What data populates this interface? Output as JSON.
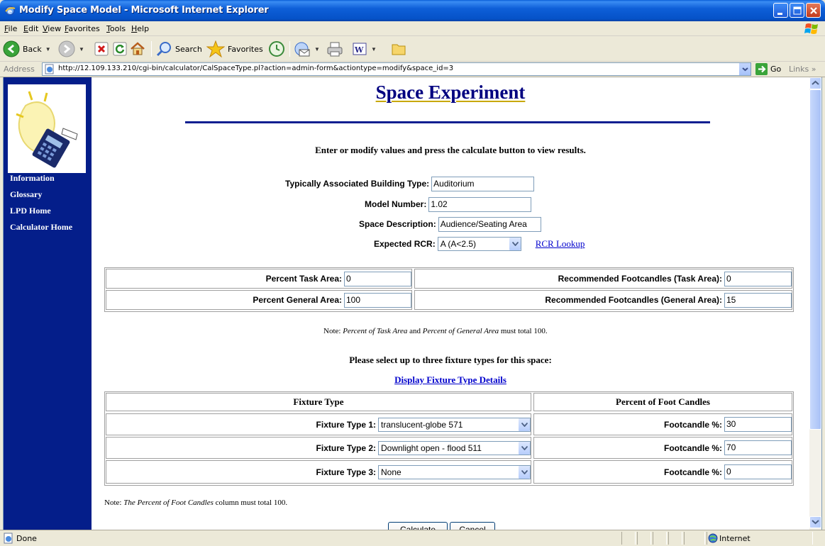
{
  "window": {
    "title": "Modify Space Model - Microsoft Internet Explorer"
  },
  "menu": [
    "File",
    "Edit",
    "View",
    "Favorites",
    "Tools",
    "Help"
  ],
  "toolbar": {
    "back_label": "Back",
    "search_label": "Search",
    "favorites_label": "Favorites"
  },
  "address": {
    "label": "Address",
    "url": "http://12.109.133.210/cgi-bin/calculator/CalSpaceType.pl?action=admin-form&actiontype=modify&space_id=3",
    "go_label": "Go",
    "links_label": "Links"
  },
  "sidebar": {
    "items": [
      "Information",
      "Glossary",
      "LPD Home",
      "Calculator Home"
    ]
  },
  "page": {
    "heading": "Space Experiment",
    "intro": "Enter or modify values and press the calculate button to view results.",
    "building_type_label": "Typically Associated Building Type:",
    "building_type_value": "Auditorium",
    "model_number_label": "Model Number:",
    "model_number_value": "1.02",
    "space_desc_label": "Space Description:",
    "space_desc_value": "Audience/Seating Area",
    "rcr_label": "Expected RCR:",
    "rcr_value": "A (A<2.5)",
    "rcr_link": "RCR Lookup",
    "percent_task_label": "Percent Task Area:",
    "percent_task_value": "0",
    "percent_general_label": "Percent General Area:",
    "percent_general_value": "100",
    "fc_task_label": "Recommended Footcandles (Task Area):",
    "fc_task_value": "0",
    "fc_general_label": "Recommended Footcandles (General Area):",
    "fc_general_value": "15",
    "note1_prefix": "Note: ",
    "note1_italic_a": "Percent of Task Area",
    "note1_and": " and ",
    "note1_italic_b": "Percent of General Area",
    "note1_suffix": "  must  total 100.",
    "select_prompt": "Please select up to three fixture types for this space:",
    "details_link": "Display Fixture Type Details",
    "col_fixture": "Fixture Type",
    "col_percent": "Percent of Foot Candles",
    "fixtures": [
      {
        "label": "Fixture Type 1:",
        "value": "translucent-globe 571",
        "pct_label": "Footcandle %:",
        "pct": "30"
      },
      {
        "label": "Fixture Type 2:",
        "value": "Downlight open - flood 511",
        "pct_label": "Footcandle %:",
        "pct": "70"
      },
      {
        "label": "Fixture Type 3:",
        "value": "None",
        "pct_label": "Footcandle %:",
        "pct": "0"
      }
    ],
    "note2_prefix": "Note: ",
    "note2_italic": "The Percent of Foot Candles",
    "note2_suffix": " column must  total 100.",
    "calculate_label": "Calculate",
    "cancel_label": "Cancel"
  },
  "status": {
    "text": "Done",
    "zone": "Internet"
  }
}
